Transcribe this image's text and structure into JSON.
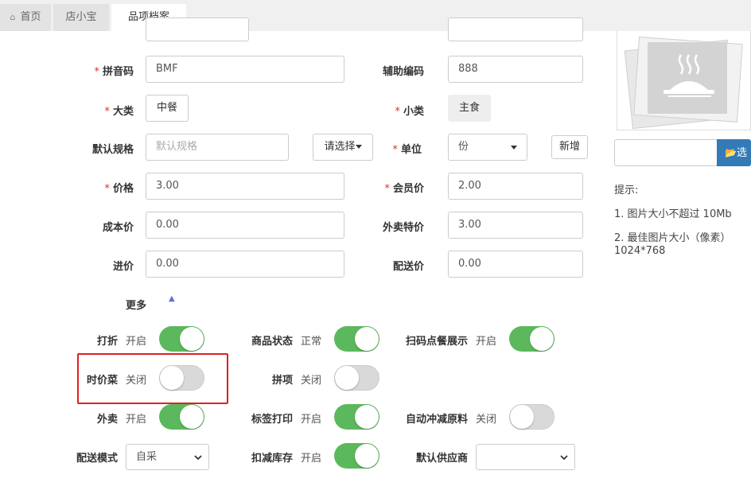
{
  "tabs": [
    {
      "label": "首页",
      "icon": "home-icon"
    },
    {
      "label": "店小宝"
    },
    {
      "label": "品项档案"
    }
  ],
  "form": {
    "pinyin": {
      "label": "拼音码",
      "value": "BMF"
    },
    "aux_code": {
      "label": "辅助编码",
      "value": "888"
    },
    "category": {
      "label": "大类",
      "value": "中餐"
    },
    "subcategory": {
      "label": "小类",
      "value": "主食"
    },
    "default_spec": {
      "label": "默认规格",
      "placeholder": "默认规格",
      "select_label": "请选择"
    },
    "unit": {
      "label": "单位",
      "value": "份",
      "add_label": "新增"
    },
    "price": {
      "label": "价格",
      "value": "3.00"
    },
    "member_price": {
      "label": "会员价",
      "value": "2.00"
    },
    "cost_price": {
      "label": "成本价",
      "value": "0.00"
    },
    "takeout_price": {
      "label": "外卖特价",
      "value": "3.00"
    },
    "purchase_price": {
      "label": "进价",
      "value": "0.00"
    },
    "delivery_price": {
      "label": "配送价",
      "value": "0.00"
    },
    "more_label": "更多"
  },
  "toggles": {
    "discount": {
      "label": "打折",
      "state": "开启"
    },
    "item_status": {
      "label": "商品状态",
      "state": "正常"
    },
    "scan_display": {
      "label": "扫码点餐展示",
      "state": "开启"
    },
    "market_price": {
      "label": "时价菜",
      "state": "关闭"
    },
    "combo": {
      "label": "拼项",
      "state": "关闭"
    },
    "takeout": {
      "label": "外卖",
      "state": "开启"
    },
    "label_print": {
      "label": "标签打印",
      "state": "开启"
    },
    "auto_deduct": {
      "label": "自动冲减原料",
      "state": "关闭"
    },
    "deduct_stock": {
      "label": "扣减库存",
      "state": "开启"
    }
  },
  "delivery_mode": {
    "label": "配送模式",
    "value": "自采"
  },
  "default_supplier": {
    "label": "默认供应商",
    "value": ""
  },
  "image_panel": {
    "select_button": "选",
    "tip_title": "提示:",
    "tip1": "1. 图片大小不超过 10Mb",
    "tip2_line1": "2. 最佳图片大小（像素）",
    "tip2_line2": "1024*768"
  },
  "colors": {
    "accent_green": "#5cb85c",
    "required_red": "#d9342b",
    "highlight_red": "#e02020",
    "primary_blue": "#337ab7"
  }
}
